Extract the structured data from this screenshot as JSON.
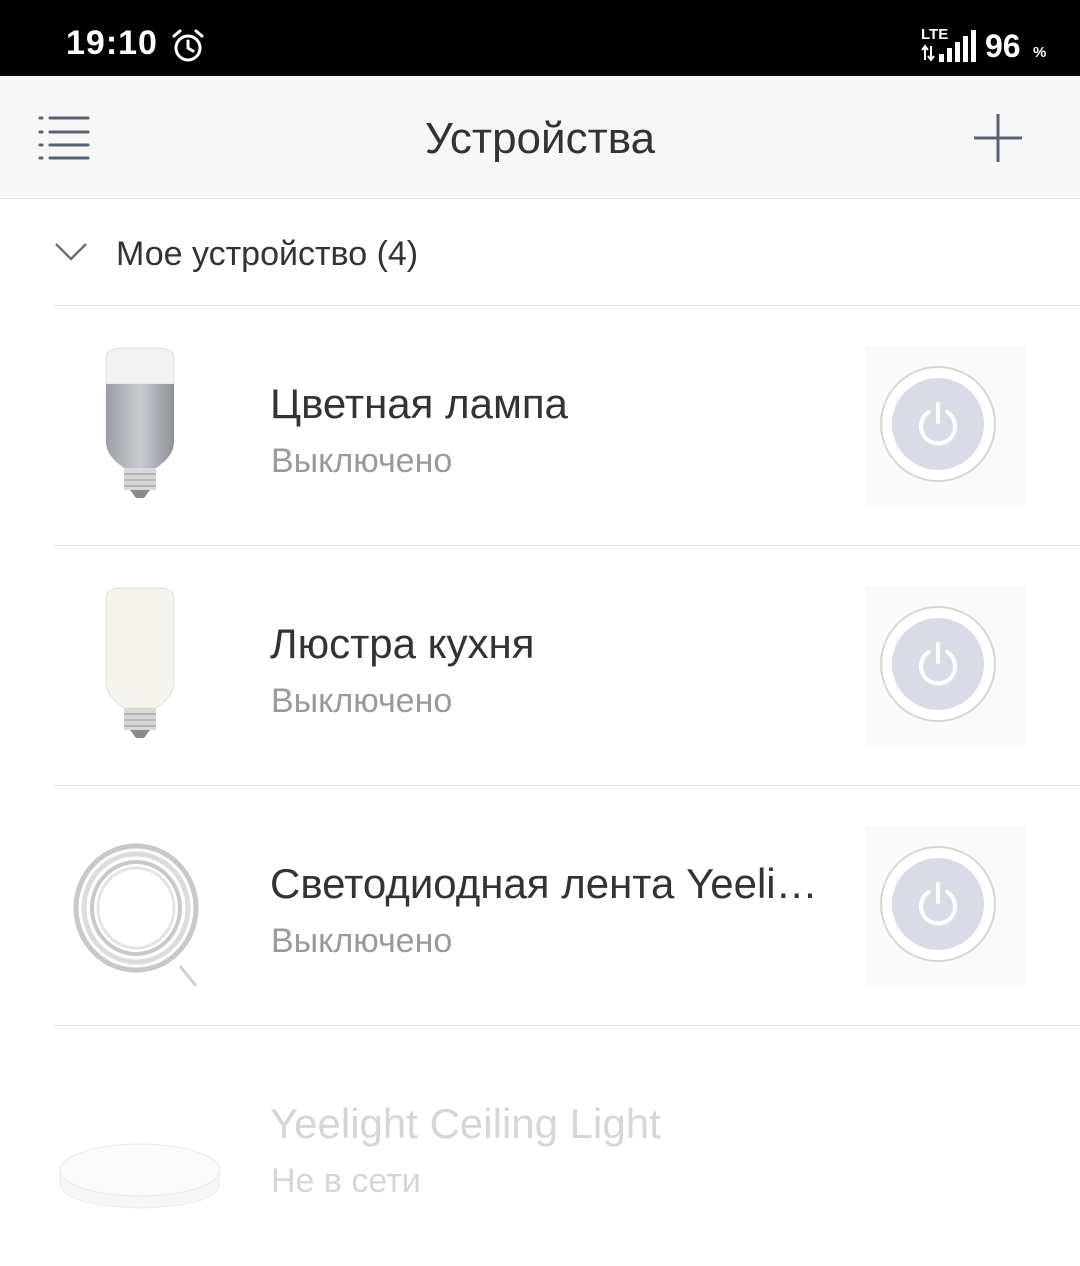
{
  "status_bar": {
    "time": "19:10",
    "network": "LTE",
    "battery": "96",
    "battery_unit": "%"
  },
  "header": {
    "title": "Устройства",
    "menu_icon": "menu-list-icon",
    "add_icon": "plus-icon"
  },
  "group": {
    "title": "Мое устройство (4)",
    "expanded": true
  },
  "devices": [
    {
      "name": "Цветная лампа",
      "status": "Выключено",
      "icon": "color-bulb-icon",
      "online": true
    },
    {
      "name": "Люстра кухня",
      "status": "Выключено",
      "icon": "white-bulb-icon",
      "online": true
    },
    {
      "name": "Светодиодная лента Yeeli…",
      "status": "Выключено",
      "icon": "led-strip-icon",
      "online": true
    },
    {
      "name": "Yeelight Ceiling Light",
      "status": "Не в сети",
      "icon": "ceiling-light-icon",
      "online": false
    }
  ],
  "colors": {
    "status_bar_bg": "#000000",
    "header_bg": "#f7f7f7",
    "power_inner": "#d9dbe6",
    "text_primary": "#333333",
    "text_secondary": "#9a9a9a",
    "text_offline": "#d6d6d6"
  }
}
